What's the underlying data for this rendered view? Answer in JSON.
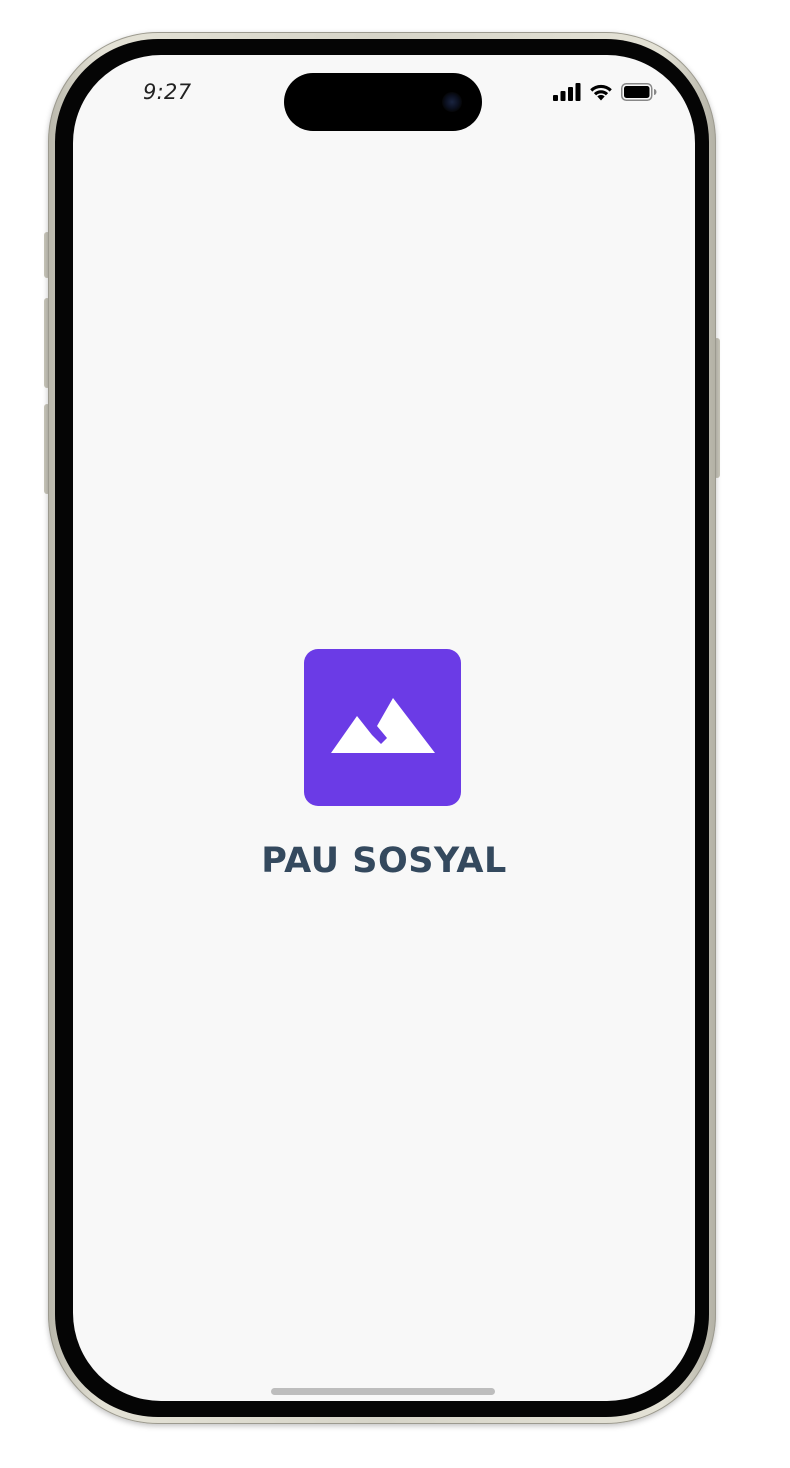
{
  "status_bar": {
    "time": "9:27",
    "icons": [
      "cellular-signal-icon",
      "wifi-icon",
      "battery-icon"
    ]
  },
  "splash": {
    "logo_icon": "mountain-icon",
    "app_name": "PAU SOSYAL"
  },
  "colors": {
    "brand": "#6B3BE6",
    "app_name_text": "#34495E",
    "screen_background": "#F8F8F8"
  }
}
